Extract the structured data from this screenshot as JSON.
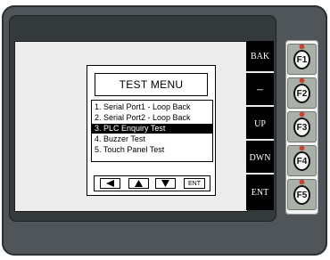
{
  "menu": {
    "title": "TEST MENU",
    "items": [
      {
        "label": "1. Serial Port1 - Loop Back",
        "selected": false
      },
      {
        "label": "2. Serial Port2 - Loop Back",
        "selected": false
      },
      {
        "label": "3. PLC Enquiry Test",
        "selected": true
      },
      {
        "label": "4. Buzzer Test",
        "selected": false
      },
      {
        "label": "5. Touch Panel Test",
        "selected": false
      }
    ],
    "nav": {
      "left_icon": "left-arrow-icon",
      "up_icon": "up-arrow-icon",
      "down_icon": "down-arrow-icon",
      "ent_label": "ENT"
    }
  },
  "side_buttons": [
    "BAK",
    "–",
    "UP",
    "DWN",
    "ENT"
  ],
  "function_keys": [
    "F1",
    "F2",
    "F3",
    "F4",
    "F5"
  ],
  "colors": {
    "device_body": "#4f5559",
    "screen_bg": "#ececec",
    "side_bar": "#000000",
    "led": "#d83b2a",
    "fkey": "#a8b0a8"
  }
}
